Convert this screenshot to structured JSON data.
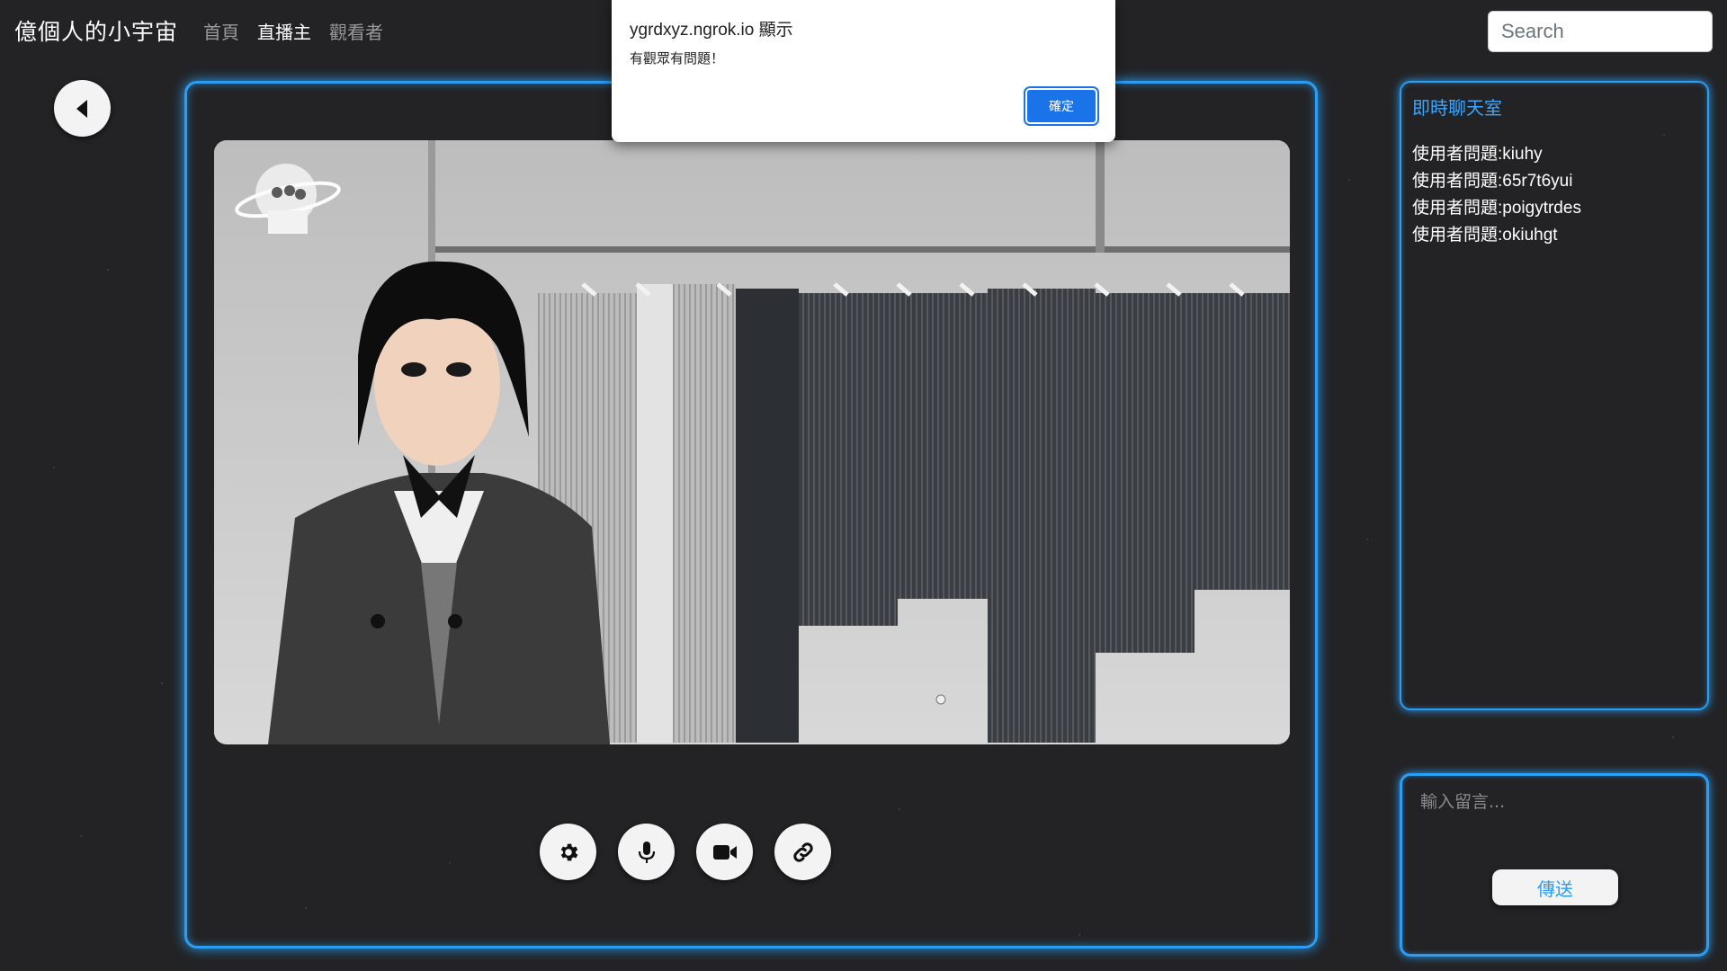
{
  "navbar": {
    "brand": "億個人的小宇宙",
    "links": [
      "首頁",
      "直播主",
      "觀看者"
    ],
    "active_link": "直播主",
    "search_placeholder": "Search"
  },
  "chat": {
    "title": "即時聊天室",
    "messages": [
      "使用者問題:kiuhy",
      "使用者問題:65r7t6yui",
      "使用者問題:poigytrdes",
      "使用者問題:okiuhgt"
    ]
  },
  "composer": {
    "placeholder": "輸入留言...",
    "send_label": "傳送"
  },
  "alert": {
    "origin": "ygrdxyz.ngrok.io 顯示",
    "message": "有觀眾有問題！",
    "ok_label": "確定"
  },
  "controls": [
    "gear-icon",
    "microphone-icon",
    "video-camera-icon",
    "link-icon"
  ],
  "colors": {
    "accent": "#2a9df4",
    "background": "#232325",
    "dialog_button": "#1a73e8"
  }
}
